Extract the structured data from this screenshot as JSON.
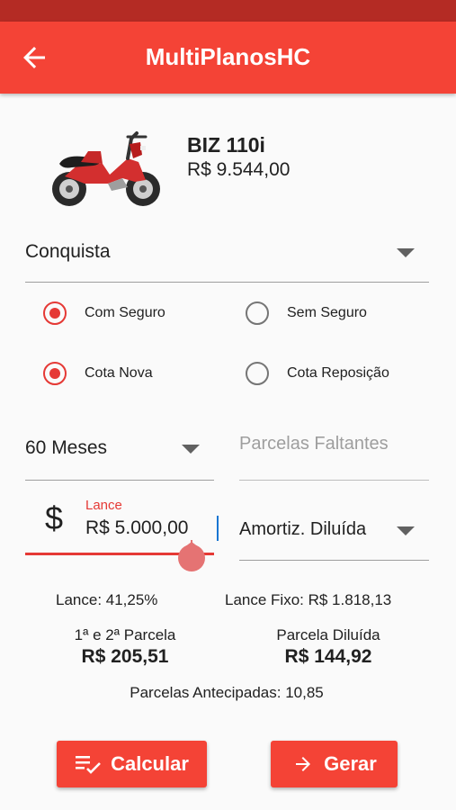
{
  "app_bar": {
    "title": "MultiPlanosHC"
  },
  "product": {
    "name": "BIZ 110i",
    "price": "R$ 9.544,00"
  },
  "plan": {
    "selected": "Conquista"
  },
  "insurance_options": [
    {
      "label": "Com Seguro",
      "selected": true
    },
    {
      "label": "Sem Seguro",
      "selected": false
    }
  ],
  "quota_options": [
    {
      "label": "Cota Nova",
      "selected": true
    },
    {
      "label": "Cota Reposição",
      "selected": false
    }
  ],
  "term": {
    "selected": "60 Meses"
  },
  "remaining_installments": {
    "placeholder": "Parcelas Faltantes"
  },
  "bid": {
    "label": "Lance",
    "value": "R$ 5.000,00",
    "icon": "$"
  },
  "amortization": {
    "selected": "Amortiz. Diluída"
  },
  "results": {
    "bid_percent": "Lance: 41,25%",
    "fixed_bid": "Lance Fixo: R$ 1.818,13",
    "first_second_label": "1ª e 2ª Parcela",
    "first_second_value": "R$ 205,51",
    "diluted_label": "Parcela Diluída",
    "diluted_value": "R$ 144,92",
    "advanced": "Parcelas Antecipadas: 10,85"
  },
  "buttons": {
    "calculate": "Calcular",
    "generate": "Gerar"
  },
  "colors": {
    "primary": "#f44336",
    "status_bar": "#b42b24",
    "accent": "#e53935"
  }
}
